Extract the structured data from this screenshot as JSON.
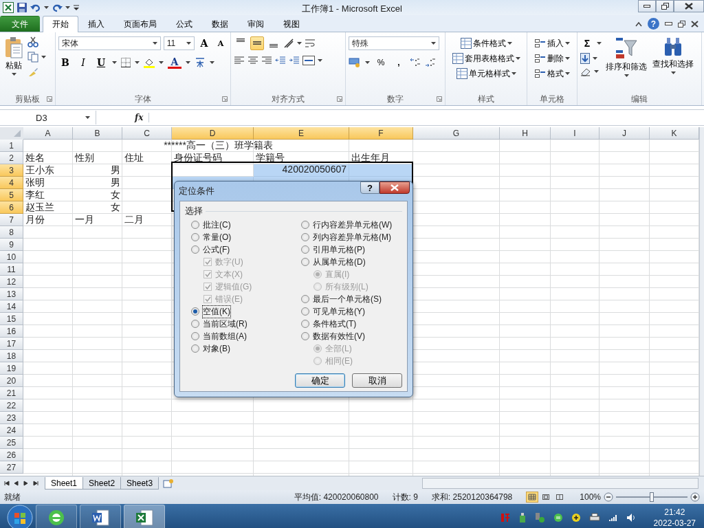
{
  "title_bar": {
    "title": "工作簿1 - Microsoft Excel"
  },
  "ribbon_tabs": [
    {
      "label": "文件",
      "kind": "file",
      "selected": false
    },
    {
      "label": "开始",
      "kind": "tab",
      "selected": true
    },
    {
      "label": "插入",
      "kind": "tab",
      "selected": false
    },
    {
      "label": "页面布局",
      "kind": "tab",
      "selected": false
    },
    {
      "label": "公式",
      "kind": "tab",
      "selected": false
    },
    {
      "label": "数据",
      "kind": "tab",
      "selected": false
    },
    {
      "label": "审阅",
      "kind": "tab",
      "selected": false
    },
    {
      "label": "视图",
      "kind": "tab",
      "selected": false
    }
  ],
  "ribbon_help": "?",
  "clipboard": {
    "paste": "粘贴",
    "label": "剪贴板"
  },
  "font": {
    "name": "宋体",
    "size": "11",
    "grow": "A",
    "shrink": "A",
    "bold": "B",
    "italic": "I",
    "underline": "U",
    "font_color_button": "A",
    "label": "字体"
  },
  "alignment": {
    "buttons": [
      {
        "kind": "top",
        "selected": false
      },
      {
        "kind": "middle",
        "selected": true
      },
      {
        "kind": "bottom",
        "selected": false
      }
    ],
    "label": "对齐方式"
  },
  "number": {
    "format": "特殊",
    "percent": "%",
    "comma": ",",
    "label": "数字"
  },
  "styles": {
    "items": [
      "条件格式",
      "套用表格格式",
      "单元格样式"
    ],
    "label": "样式"
  },
  "cells_group": {
    "items": [
      "插入",
      "删除",
      "格式"
    ],
    "label": "单元格"
  },
  "editing": {
    "sum": "Σ",
    "sort": "排序和筛选",
    "find": "查找和选择",
    "label": "编辑"
  },
  "formula_bar": {
    "name_box": "D3",
    "fx": "fx"
  },
  "columns": [
    {
      "label": "A",
      "selected": false
    },
    {
      "label": "B",
      "selected": false
    },
    {
      "label": "C",
      "selected": false
    },
    {
      "label": "D",
      "selected": true
    },
    {
      "label": "E",
      "selected": true
    },
    {
      "label": "F",
      "selected": true
    },
    {
      "label": "G",
      "selected": false
    },
    {
      "label": "H",
      "selected": false
    },
    {
      "label": "I",
      "selected": false
    },
    {
      "label": "J",
      "selected": false
    },
    {
      "label": "K",
      "selected": false
    }
  ],
  "rows": [
    {
      "number": "1",
      "selected": false,
      "title": "******高一（三）班学籍表"
    },
    {
      "number": "2",
      "selected": false,
      "cells": [
        {
          "text": "姓名"
        },
        {
          "text": "性别"
        },
        {
          "text": "住址"
        },
        {
          "text": "身份证号码"
        },
        {
          "text": "学籍号"
        },
        {
          "text": "出生年月"
        }
      ]
    },
    {
      "number": "3",
      "selected": true,
      "cells": [
        {
          "text": "王小东"
        },
        {
          "text": "男",
          "right_aligned": true
        },
        null,
        null,
        {
          "text": "420020050607",
          "right_aligned": true,
          "selected": true
        },
        {
          "selected": true
        }
      ]
    },
    {
      "number": "4",
      "selected": true,
      "cells": [
        {
          "text": "张明"
        },
        {
          "text": "男",
          "right_aligned": true
        },
        null,
        {
          "selected": true
        },
        {
          "selected": true
        },
        {
          "selected": true
        }
      ]
    },
    {
      "number": "5",
      "selected": true,
      "cells": [
        {
          "text": "李红"
        },
        {
          "text": "女",
          "right_aligned": true
        }
      ]
    },
    {
      "number": "6",
      "selected": true,
      "cells": [
        {
          "text": "赵玉兰"
        },
        {
          "text": "女",
          "right_aligned": true
        }
      ]
    },
    {
      "number": "7",
      "selected": false,
      "cells": [
        {
          "text": "月份"
        },
        {
          "text": "一月"
        },
        {
          "text": "二月"
        }
      ]
    },
    {
      "number": "8",
      "selected": false
    },
    {
      "number": "9",
      "selected": false
    },
    {
      "number": "10",
      "selected": false
    },
    {
      "number": "11",
      "selected": false
    },
    {
      "number": "12",
      "selected": false
    },
    {
      "number": "13",
      "selected": false
    },
    {
      "number": "14",
      "selected": false
    },
    {
      "number": "15",
      "selected": false
    },
    {
      "number": "16",
      "selected": false
    },
    {
      "number": "17",
      "selected": false
    },
    {
      "number": "18",
      "selected": false
    },
    {
      "number": "19",
      "selected": false
    },
    {
      "number": "20",
      "selected": false
    },
    {
      "number": "21",
      "selected": false
    },
    {
      "number": "22",
      "selected": false
    },
    {
      "number": "23",
      "selected": false
    },
    {
      "number": "24",
      "selected": false
    },
    {
      "number": "25",
      "selected": false
    },
    {
      "number": "26",
      "selected": false
    },
    {
      "number": "27",
      "selected": false
    }
  ],
  "dialog": {
    "title": "定位条件",
    "help": "?",
    "group_label": "选择",
    "left_options": [
      {
        "kind": "radio",
        "label": "批注(C)",
        "selected": false,
        "focused": false
      },
      {
        "kind": "radio",
        "label": "常量(O)",
        "selected": false,
        "focused": false
      },
      {
        "kind": "radio",
        "label": "公式(F)",
        "selected": false,
        "focused": false,
        "children": [
          {
            "kind": "checkbox",
            "label": "数字(U)",
            "checked": true,
            "disabled": true
          },
          {
            "kind": "checkbox",
            "label": "文本(X)",
            "checked": true,
            "disabled": true
          },
          {
            "kind": "checkbox",
            "label": "逻辑值(G)",
            "checked": true,
            "disabled": true
          },
          {
            "kind": "checkbox",
            "label": "错误(E)",
            "checked": true,
            "disabled": true
          }
        ]
      },
      {
        "kind": "radio",
        "label": "空值(K)",
        "selected": true,
        "focused": true
      },
      {
        "kind": "radio",
        "label": "当前区域(R)",
        "selected": false,
        "focused": false
      },
      {
        "kind": "radio",
        "label": "当前数组(A)",
        "selected": false,
        "focused": false
      },
      {
        "kind": "radio",
        "label": "对象(B)",
        "selected": false,
        "focused": false
      }
    ],
    "right_options": [
      {
        "kind": "radio",
        "label": "行内容差异单元格(W)",
        "selected": false,
        "focused": false
      },
      {
        "kind": "radio",
        "label": "列内容差异单元格(M)",
        "selected": false,
        "focused": false
      },
      {
        "kind": "radio",
        "label": "引用单元格(P)",
        "selected": false,
        "focused": false
      },
      {
        "kind": "radio",
        "label": "从属单元格(D)",
        "selected": false,
        "focused": false,
        "children": [
          {
            "kind": "radio",
            "label": "直属(I)",
            "selected": true,
            "disabled": true
          },
          {
            "kind": "radio",
            "label": "所有级别(L)",
            "selected": false,
            "disabled": true
          }
        ]
      },
      {
        "kind": "radio",
        "label": "最后一个单元格(S)",
        "selected": false,
        "focused": false
      },
      {
        "kind": "radio",
        "label": "可见单元格(Y)",
        "selected": false,
        "focused": false
      },
      {
        "kind": "radio",
        "label": "条件格式(T)",
        "selected": false,
        "focused": false
      },
      {
        "kind": "radio",
        "label": "数据有效性(V)",
        "selected": false,
        "focused": false,
        "children": [
          {
            "kind": "radio",
            "label": "全部(L)",
            "selected": true,
            "disabled": true
          },
          {
            "kind": "radio",
            "label": "相同(E)",
            "selected": false,
            "disabled": true
          }
        ]
      }
    ],
    "buttons": [
      {
        "label": "确定",
        "default": true
      },
      {
        "label": "取消",
        "default": false
      }
    ]
  },
  "sheet_tabs": [
    {
      "label": "Sheet1",
      "selected": true
    },
    {
      "label": "Sheet2",
      "selected": false
    },
    {
      "label": "Sheet3",
      "selected": false
    }
  ],
  "status_bar": {
    "state": "就绪",
    "average": "平均值: 420020060800",
    "count": "计数: 9",
    "sum": "求和: 2520120364798",
    "views": [
      {
        "kind": "normal",
        "selected": true
      },
      {
        "kind": "layout",
        "selected": false
      },
      {
        "kind": "break",
        "selected": false
      }
    ],
    "zoom": "100%",
    "zoom_level": {
      "level": 0.5
    }
  },
  "taskbar": {
    "apps": [
      {
        "kind": "ie",
        "selected": false
      },
      {
        "kind": "word",
        "selected": false
      },
      {
        "kind": "excel",
        "selected": true
      }
    ],
    "time": "21:42",
    "date": "2022-03-27"
  }
}
